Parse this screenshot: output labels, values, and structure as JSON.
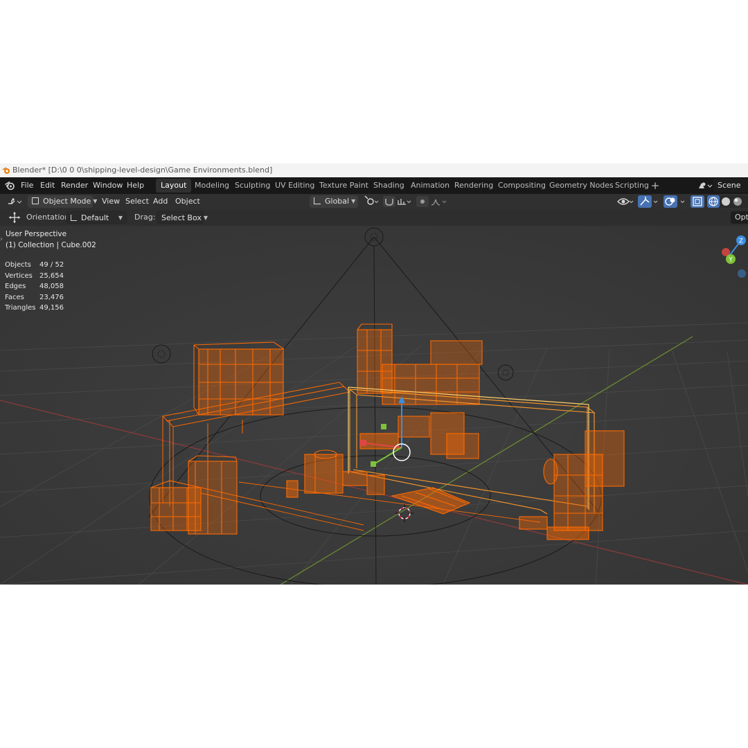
{
  "window": {
    "title": "Blender* [D:\\0 0 0\\shipping-level-design\\Game Environments.blend]"
  },
  "menu": [
    "File",
    "Edit",
    "Render",
    "Window",
    "Help"
  ],
  "workspaces": [
    "Layout",
    "Modeling",
    "Sculpting",
    "UV Editing",
    "Texture Paint",
    "Shading",
    "Animation",
    "Rendering",
    "Compositing",
    "Geometry Nodes",
    "Scripting"
  ],
  "active_workspace": "Layout",
  "scene": {
    "name": "Scene"
  },
  "header": {
    "mode": "Object Mode",
    "menus": [
      "View",
      "Select",
      "Add",
      "Object"
    ],
    "transform_orientation": "Global"
  },
  "tool_settings": {
    "orientation_label": "Orientation:",
    "orientation_value": "Default",
    "drag_label": "Drag:",
    "drag_value": "Select Box",
    "options_label": "Options"
  },
  "viewport": {
    "view_name": "User Perspective",
    "active": "(1) Collection | Cube.002",
    "stats": [
      {
        "label": "Objects",
        "value": "49 / 52"
      },
      {
        "label": "Vertices",
        "value": "25,654"
      },
      {
        "label": "Edges",
        "value": "48,058"
      },
      {
        "label": "Faces",
        "value": "23,476"
      },
      {
        "label": "Triangles",
        "value": "49,156"
      }
    ],
    "gizmo_axes": [
      "Z",
      "Y"
    ]
  },
  "colors": {
    "selection": "#ff6a00",
    "active_outline": "#ffd06a",
    "x_axis": "#c4443f",
    "y_axis": "#7fa63a",
    "z_axis": "#3d8fe0"
  }
}
